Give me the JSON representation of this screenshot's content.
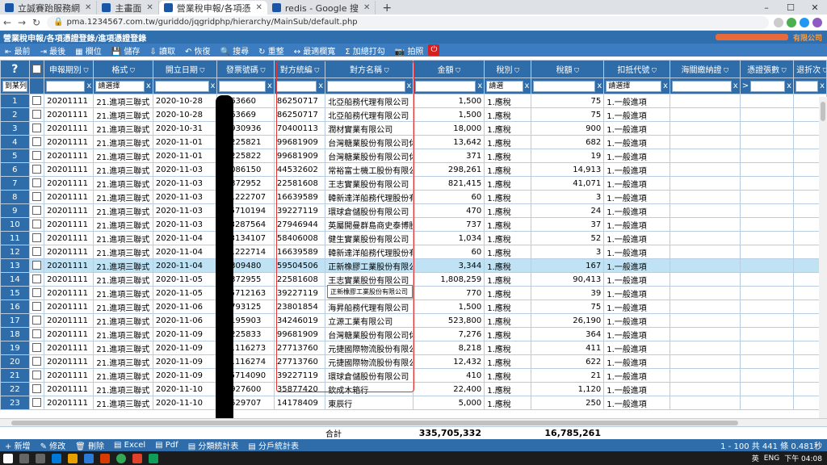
{
  "browser": {
    "tabs": [
      "立誠賽跆服務網",
      "主畫面",
      "營業稅申報/各項憑",
      "redis - Google 搜"
    ],
    "url": "pma.1234567.com.tw/guriddo/jqgridphp/hierarchy/MainSub/default.php"
  },
  "app": {
    "title": "營業稅申報/各項憑證登錄/進項憑證登錄",
    "company": "有限公司"
  },
  "toolbar": [
    "最前",
    "最後",
    "欄位",
    "儲存",
    "讀取",
    "恢復",
    "搜尋",
    "重整",
    "最適欄寬",
    "加總打勾",
    "拍照"
  ],
  "columns": [
    "",
    "",
    "申報期別",
    "格式",
    "開立日期",
    "發票號碼",
    "對方統編",
    "對方名稱",
    "金額",
    "稅別",
    "稅額",
    "扣抵代號",
    "海關繳納證",
    "憑證張數",
    "退折次"
  ],
  "filter": {
    "search_label": "到某列",
    "select_placeholder": "請選擇",
    "select_short": "請選",
    "gt": ">"
  },
  "rows": [
    [
      "1",
      "20201111",
      "21.進項三聯式",
      "2020-10-28",
      "1663660",
      "86250717",
      "北亞船務代理有限公司",
      "1,500",
      "1.應稅",
      "75",
      "1.一般進項"
    ],
    [
      "2",
      "20201111",
      "21.進項三聯式",
      "2020-10-28",
      "1663669",
      "86250717",
      "北亞船務代理有限公司",
      "1,500",
      "1.應稅",
      "75",
      "1.一般進項"
    ],
    [
      "3",
      "20201111",
      "21.進項三聯式",
      "2020-10-31",
      "01930936",
      "70400113",
      "潤材實業有限公司",
      "18,000",
      "1.應稅",
      "900",
      "1.一般進項"
    ],
    [
      "4",
      "20201111",
      "21.進項三聯式",
      "2020-11-01",
      "16225821",
      "99681909",
      "台灣糖業股份有限公司休",
      "13,642",
      "1.應稅",
      "682",
      "1.一般進項"
    ],
    [
      "5",
      "20201111",
      "21.進項三聯式",
      "2020-11-01",
      "16225822",
      "99681909",
      "台灣糖業股份有限公司休",
      "371",
      "1.應稅",
      "19",
      "1.一般進項"
    ],
    [
      "6",
      "20201111",
      "21.進項三聯式",
      "2020-11-03",
      "41086150",
      "44532602",
      "常裕富士機工股份有限公",
      "298,261",
      "1.應稅",
      "14,913",
      "1.一般進項"
    ],
    [
      "7",
      "20201111",
      "21.進項三聯式",
      "2020-11-03",
      "44372952",
      "22581608",
      "王志實業股份有限公司",
      "821,415",
      "1.應稅",
      "41,071",
      "1.一般進項"
    ],
    [
      "8",
      "20201111",
      "21.進項三聯式",
      "2020-11-03",
      "F11222707",
      "16639589",
      "韓新達洋船務代理股份有",
      "60",
      "1.應稅",
      "3",
      "1.一般進項"
    ],
    [
      "9",
      "20201111",
      "21.進項三聯式",
      "2020-11-03",
      "F35710194",
      "39227119",
      "環球倉儲股份有限公司",
      "470",
      "1.應稅",
      "24",
      "1.一般進項"
    ],
    [
      "10",
      "20201111",
      "21.進項三聯式",
      "2020-11-03",
      "F43287564",
      "27946944",
      "英屬開曼群島商史泰博股",
      "737",
      "1.應稅",
      "37",
      "1.一般進項"
    ],
    [
      "11",
      "20201111",
      "21.進項三聯式",
      "2020-11-04",
      "F23134107",
      "58406008",
      "健生實業股份有限公司",
      "1,034",
      "1.應稅",
      "52",
      "1.一般進項"
    ],
    [
      "12",
      "20201111",
      "21.進項三聯式",
      "2020-11-04",
      "F11222714",
      "16639589",
      "韓新達洋船務代理股份有",
      "60",
      "1.應稅",
      "3",
      "1.一般進項"
    ],
    [
      "13",
      "20201111",
      "21.進項三聯式",
      "2020-11-04",
      "62309480",
      "59504506",
      "正新橡膠工業股份有限公",
      "3,344",
      "1.應稅",
      "167",
      "1.一般進項"
    ],
    [
      "14",
      "20201111",
      "21.進項三聯式",
      "2020-11-05",
      "44372955",
      "22581608",
      "王志實業股份有限公司",
      "1,808,259",
      "1.應稅",
      "90,413",
      "1.一般進項"
    ],
    [
      "15",
      "20201111",
      "21.進項三聯式",
      "2020-11-05",
      "F35712163",
      "39227119",
      "環球倉儲股份有限公司",
      "770",
      "1.應稅",
      "39",
      "1.一般進項"
    ],
    [
      "16",
      "20201111",
      "21.進項三聯式",
      "2020-11-06",
      "11793125",
      "23801854",
      "海昇船務代理有限公司",
      "1,500",
      "1.應稅",
      "75",
      "1.一般進項"
    ],
    [
      "17",
      "20201111",
      "21.進項三聯式",
      "2020-11-06",
      "38195903",
      "34246019",
      "立源工業有限公司",
      "523,800",
      "1.應稅",
      "26,190",
      "1.一般進項"
    ],
    [
      "18",
      "20201111",
      "21.進項三聯式",
      "2020-11-09",
      "16225833",
      "99681909",
      "台灣糖業股份有限公司休",
      "7,276",
      "1.應稅",
      "364",
      "1.一般進項"
    ],
    [
      "19",
      "20201111",
      "21.進項三聯式",
      "2020-11-09",
      "F31116273",
      "27713760",
      "元捷國際物流股份有限公",
      "8,218",
      "1.應稅",
      "411",
      "1.一般進項"
    ],
    [
      "20",
      "20201111",
      "21.進項三聯式",
      "2020-11-09",
      "F31116274",
      "27713760",
      "元捷國際物流股份有限公",
      "12,432",
      "1.應稅",
      "622",
      "1.一般進項"
    ],
    [
      "21",
      "20201111",
      "21.進項三聯式",
      "2020-11-09",
      "F35714090",
      "39227119",
      "環球倉儲股份有限公司",
      "410",
      "1.應稅",
      "21",
      "1.一般進項"
    ],
    [
      "22",
      "20201111",
      "21.進項三聯式",
      "2020-11-10",
      "05927600",
      "35877420",
      "欽成木箱行",
      "22,400",
      "1.應稅",
      "1,120",
      "1.一般進項"
    ],
    [
      "23",
      "20201111",
      "21.進項三聯式",
      "2020-11-10",
      "06529707",
      "14178409",
      "東辰行",
      "5,000",
      "1.應稅",
      "250",
      "1.一般進項"
    ]
  ],
  "tooltip": "正新橡膠工業股份有限公司",
  "totals": {
    "label": "合計",
    "amount": "335,705,332",
    "tax": "16,785,261"
  },
  "bottom": {
    "actions": [
      "新增",
      "修改",
      "刪除",
      "Excel",
      "Pdf",
      "分類統計表",
      "分戶統計表"
    ],
    "pager": "1 - 100 共 441 條 0.481秒"
  },
  "taskbar": {
    "time": "下午 04:08",
    "lang": "英",
    "ime": "ENG"
  }
}
